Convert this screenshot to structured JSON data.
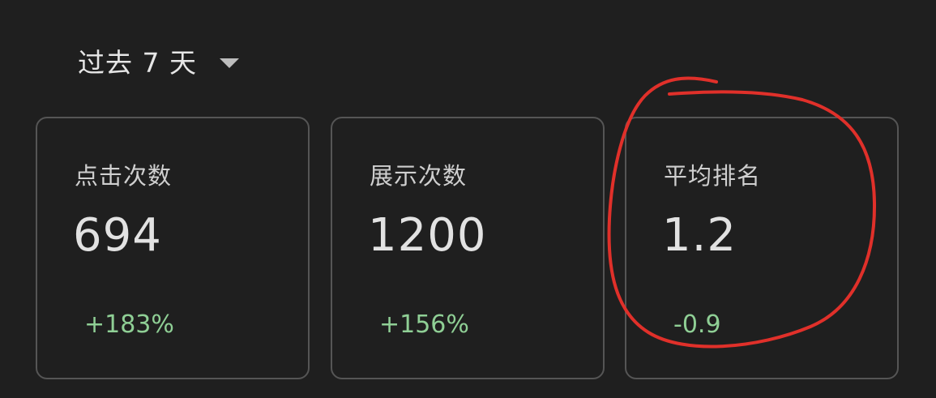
{
  "header": {
    "period_label": "过去 7 天"
  },
  "metrics": [
    {
      "title": "点击次数",
      "value": "694",
      "delta": "+183%"
    },
    {
      "title": "展示次数",
      "value": "1200",
      "delta": "+156%"
    },
    {
      "title": "平均排名",
      "value": "1.2",
      "delta": "-0.9"
    }
  ],
  "colors": {
    "background": "#1f1f1f",
    "card_border": "#555555",
    "delta_positive": "#8fcf95",
    "annotation": "#e0302a"
  },
  "icons": {
    "period_dropdown": "chevron-down-icon"
  }
}
